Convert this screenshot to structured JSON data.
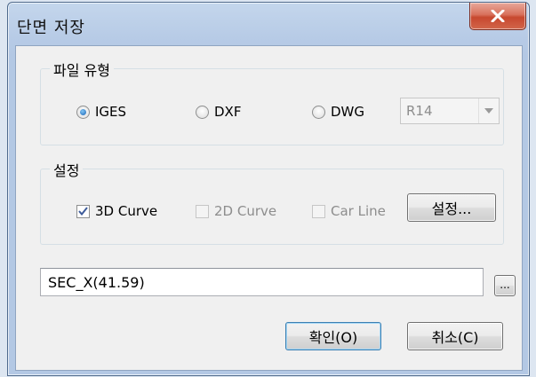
{
  "window": {
    "title": "단면 저장",
    "close_label": "X"
  },
  "file_type": {
    "label": "파일 유형",
    "options": [
      {
        "label": "IGES",
        "checked": true
      },
      {
        "label": "DXF",
        "checked": false
      },
      {
        "label": "DWG",
        "checked": false
      }
    ],
    "version_select": {
      "value": "R14",
      "enabled": false
    }
  },
  "settings": {
    "label": "설정",
    "checkboxes": [
      {
        "label": "3D Curve",
        "checked": true,
        "enabled": true
      },
      {
        "label": "2D Curve",
        "checked": false,
        "enabled": false
      },
      {
        "label": "Car Line",
        "checked": false,
        "enabled": false
      }
    ],
    "settings_button": "설정..."
  },
  "path": {
    "value": "SEC_X(41.59)",
    "browse_label": "..."
  },
  "buttons": {
    "ok": "확인(O)",
    "cancel": "취소(C)"
  }
}
